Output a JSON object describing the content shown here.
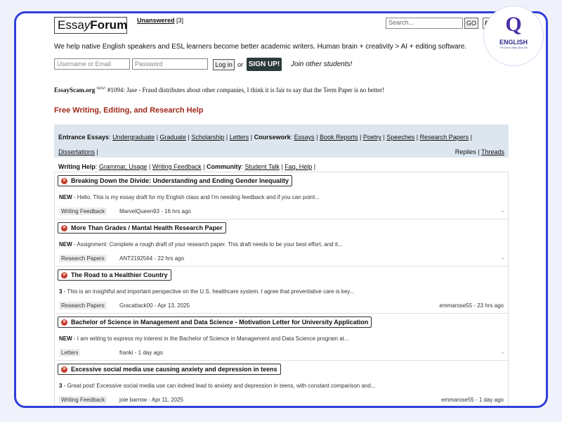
{
  "header": {
    "logo_prefix": "Essa",
    "logo_y": "y",
    "logo_suffix": "Forum",
    "unanswered_label": "Unanswered",
    "unanswered_count": "[3]",
    "search_placeholder": "Search...",
    "go_label": "GO",
    "dark_label": "DrA"
  },
  "tagline": "We help native English speakers and ESL learners become better academic writers. Human brain + creativity > AI + editing software.",
  "login": {
    "username_placeholder": "Username or Email",
    "password_placeholder": "Password",
    "login_label": "Log in",
    "or_label": "or",
    "signup_label": "SIGN UP!",
    "join_label": "Join other students!"
  },
  "scam": {
    "site": "EssayScam.org",
    "sup": "NEW!",
    "text": "#1094: Jase - Fraud distributes about other companies, I think it is fair to say that the Term Paper is no better!"
  },
  "section_title": "Free Writing, Editing, and Research Help",
  "categories": {
    "entrance_head": "Entrance Essays",
    "undergraduate": "Undergraduate",
    "graduate": "Graduate",
    "scholarship": "Scholarship",
    "letters": "Letters",
    "coursework_head": "Coursework",
    "essays": "Essays",
    "book_reports": "Book Reports",
    "poetry": "Poetry",
    "speeches": "Speeches",
    "research_papers": "Research Papers",
    "dissertations": "Dissertations",
    "writing_help_head": "Writing Help",
    "grammar": "Grammar, Usage",
    "writing_feedback": "Writing Feedback",
    "community_head": "Community",
    "student_talk": "Student Talk",
    "faq": "Faq, Help",
    "replies": "Replies",
    "threads": "Threads"
  },
  "threads": [
    {
      "title": "Breaking Down the Divide: Understanding and Ending Gender Inequality",
      "badge": "NEW",
      "snippet": "- Hello. This is my essay draft for my English class and I'm needing feedback and if you can point...",
      "category": "Writing Feedback",
      "author": "MarvelQueen93 - 16 hrs ago",
      "reply": "-"
    },
    {
      "title": "More Than Grades / Mantal Health Research Paper",
      "badge": "NEW",
      "snippet": "- Assignment: Complete a rough draft of your research paper. This draft needs to be your best effort, and it...",
      "category": "Research Papers",
      "author": "ANT2192564 - 22 hrs ago",
      "reply": "-"
    },
    {
      "title": "The Road to a Healthier Country",
      "badge": "3",
      "snippet": "- This is an insightful and important perspective on the U.S. healthcare system. I agree that preventative care is key...",
      "category": "Research Papers",
      "author": "Gracattack00 - Apr 13, 2025",
      "reply": "emmarose55 - 23 hrs ago"
    },
    {
      "title": "Bachelor of Science in Management and Data Science - Motivation Letter for University Application",
      "badge": "NEW",
      "snippet": "- I am writing to express my interest in the Bachelor of Science in Management and Data Science program at...",
      "category": "Letters",
      "author": "franki - 1 day ago",
      "reply": "-"
    },
    {
      "title": "Excessive social media use causing anxiety and depression in teens",
      "badge": "3",
      "snippet": "- Great post! Excessive social media use can indeed lead to anxiety and depression in teens, with constant comparison and...",
      "category": "Writing Feedback",
      "author": "joie barrow - Apr 11, 2025",
      "reply": "emmarose55 - 1 day ago"
    }
  ],
  "watermark": {
    "letter": "Q",
    "brand": "ENGLISH",
    "sub": "Tổ Chức Giáo Dục Úc"
  }
}
